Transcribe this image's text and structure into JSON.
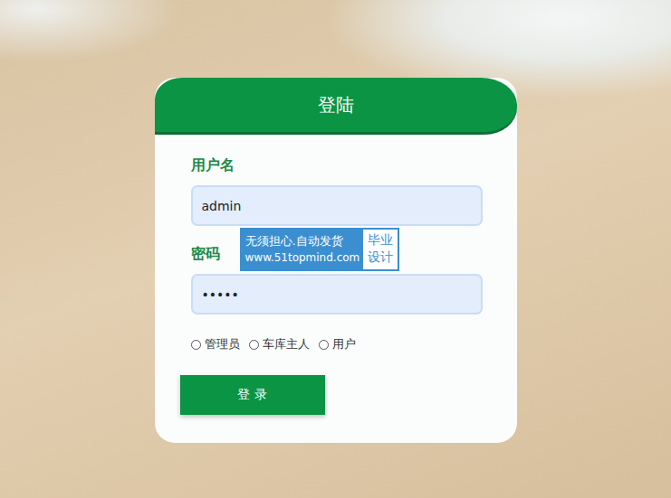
{
  "title": "登陆",
  "fields": [
    {
      "label": "用户名",
      "value": "admin"
    },
    {
      "label": "密码",
      "value": "•••••"
    }
  ],
  "roles": [
    {
      "label": "管理员",
      "selected": false
    },
    {
      "label": "车库主人",
      "selected": false
    },
    {
      "label": "用户",
      "selected": false
    }
  ],
  "button": "登 录",
  "watermark": {
    "line1": "无须担心.自动发货",
    "line2": "www.51topmind.com",
    "side": [
      "毕业",
      "设计"
    ]
  }
}
